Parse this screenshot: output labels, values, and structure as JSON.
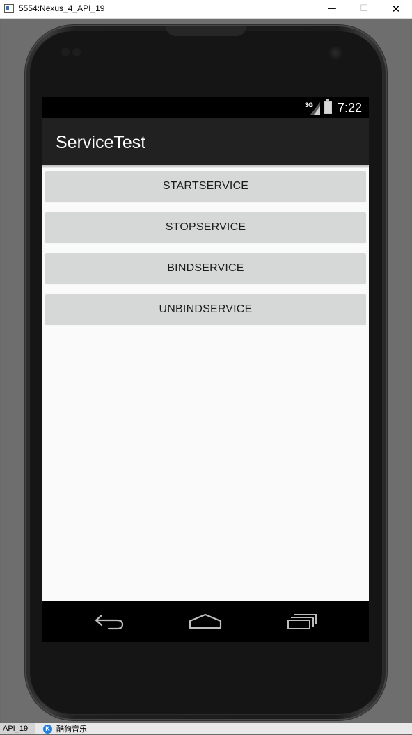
{
  "window": {
    "title": "5554:Nexus_4_API_19",
    "minimize_glyph": "—",
    "maximize_glyph": "☐",
    "close_glyph": "✕"
  },
  "status_bar": {
    "network_type": "3G",
    "time": "7:22"
  },
  "app": {
    "title": "ServiceTest"
  },
  "buttons": [
    {
      "label": "STARTSERVICE"
    },
    {
      "label": "STOPSERVICE"
    },
    {
      "label": "BINDSERVICE"
    },
    {
      "label": "UNBINDSERVICE"
    }
  ],
  "nav": {
    "icons": [
      "back-icon",
      "home-icon",
      "recent-apps-icon"
    ]
  },
  "taskbar": {
    "item_label": "API_19",
    "app_icon_letter": "K",
    "app_label": "酷狗音乐"
  },
  "colors": {
    "status_bar": "#000000",
    "action_bar": "#212121",
    "screen_background": "#fafafa",
    "button_background": "#d6d7d7",
    "nav_bar": "#000000"
  }
}
